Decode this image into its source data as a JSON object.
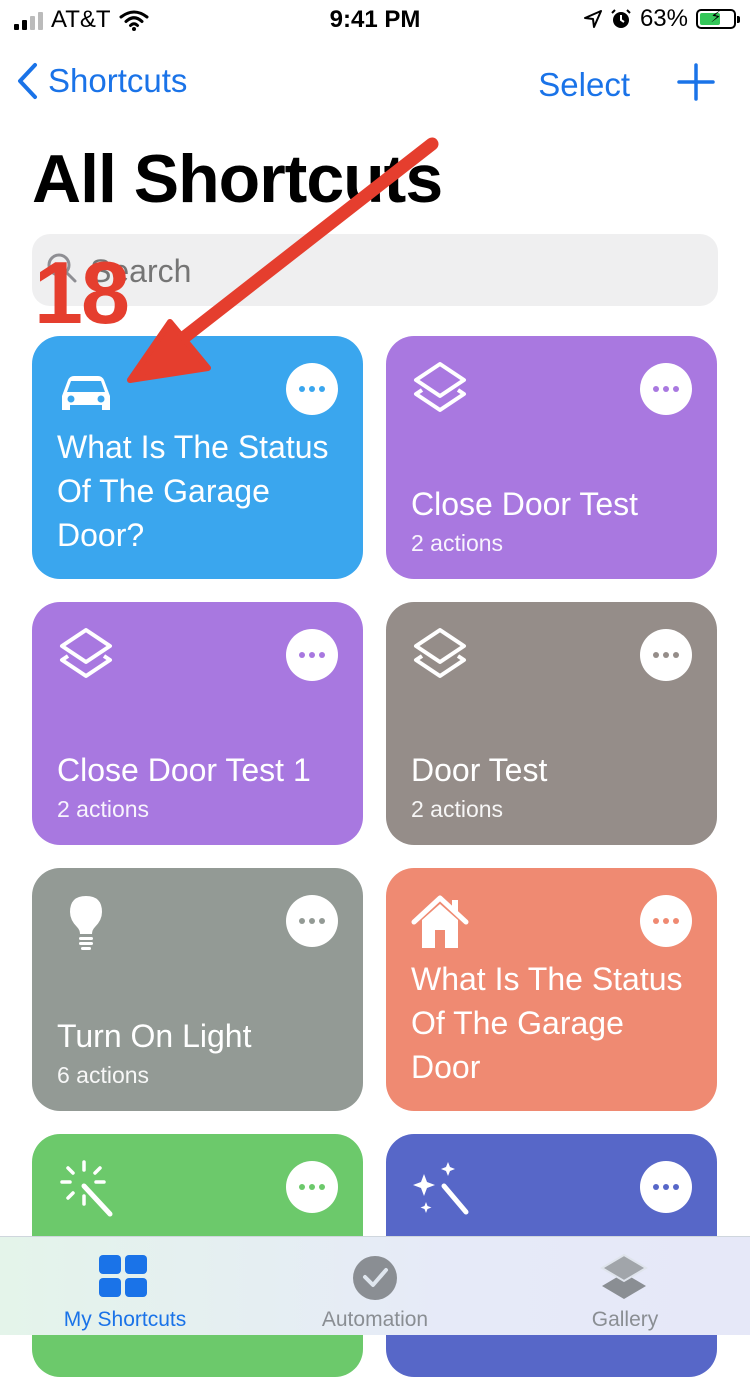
{
  "status_bar": {
    "carrier": "AT&T",
    "time": "9:41 PM",
    "battery": "63%",
    "battery_level": 0.63
  },
  "nav": {
    "back_label": "Shortcuts",
    "select_label": "Select"
  },
  "page_title": "All Shortcuts",
  "search": {
    "placeholder": "Search"
  },
  "annotation": {
    "step_number": "18",
    "color": "#e53e2e"
  },
  "shortcuts": [
    {
      "title": "What Is The Status Of The Garage Door?",
      "subtitle": "",
      "icon": "car-icon",
      "color": "#3aa6ee"
    },
    {
      "title": "Close Door Test",
      "subtitle": "2 actions",
      "icon": "layers-icon",
      "color": "#a978e0"
    },
    {
      "title": "Close Door Test 1",
      "subtitle": "2 actions",
      "icon": "layers-icon",
      "color": "#a878e0"
    },
    {
      "title": "Door Test",
      "subtitle": "2 actions",
      "icon": "layers-icon",
      "color": "#958d89"
    },
    {
      "title": "Turn On Light",
      "subtitle": "6 actions",
      "icon": "lightbulb-icon",
      "color": "#939a95"
    },
    {
      "title": "What Is The Status Of The Garage Door",
      "subtitle": "",
      "icon": "house-icon",
      "color": "#ef8a72"
    },
    {
      "title": "",
      "subtitle": "",
      "icon": "magic-wand-icon",
      "color": "#6cc96b"
    },
    {
      "title": "",
      "subtitle": "",
      "icon": "sparkles-wand-icon",
      "color": "#5767c8"
    }
  ],
  "tabs": [
    {
      "label": "My Shortcuts",
      "icon": "grid-icon",
      "active": true
    },
    {
      "label": "Automation",
      "icon": "clock-check-icon",
      "active": false
    },
    {
      "label": "Gallery",
      "icon": "stack-icon",
      "active": false
    }
  ]
}
